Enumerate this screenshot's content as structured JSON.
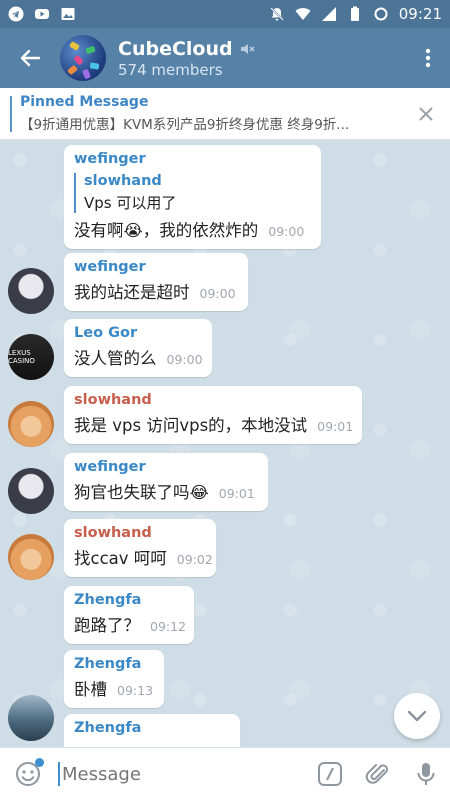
{
  "status_bar": {
    "time": "09:21",
    "left_icons": [
      "telegram-icon",
      "youtube-icon",
      "image-icon"
    ],
    "right_icons": [
      "mute-bell-icon",
      "wifi-icon",
      "signal-icon",
      "battery-icon",
      "sync-icon"
    ]
  },
  "header": {
    "title": "CubeCloud",
    "subtitle": "574 members",
    "muted_icon": "muted-speaker-icon"
  },
  "pinned": {
    "title": "Pinned Message",
    "body": "【9折通用优惠】KVM系列产品9折终身优惠  终身9折..."
  },
  "messages": [
    {
      "sender": "wefinger",
      "sender_color": "#3a88c6",
      "reply_to": "slowhand",
      "reply_text": "Vps 可以用了",
      "text": "没有啊😭，我的依然炸的",
      "time": "09:00"
    },
    {
      "sender": "wefinger",
      "sender_color": "#3a88c6",
      "text": "我的站还是超时",
      "time": "09:00"
    },
    {
      "sender": "Leo Gor",
      "sender_color": "#3a88c6",
      "text": "没人管的么",
      "time": "09:00",
      "avatar_text": "LEXUS CASINO"
    },
    {
      "sender": "slowhand",
      "sender_color": "#c65f4c",
      "text": "我是 vps 访问vps的，本地没试",
      "time": "09:01"
    },
    {
      "sender": "wefinger",
      "sender_color": "#3a88c6",
      "text": "狗官也失联了吗😂",
      "time": "09:01"
    },
    {
      "sender": "slowhand",
      "sender_color": "#c65f4c",
      "text": "找ccav 呵呵",
      "time": "09:02"
    },
    {
      "sender": "Zhengfa",
      "sender_color": "#3a88c6",
      "text": "跑路了？",
      "time": "09:12"
    },
    {
      "sender": "Zhengfa",
      "sender_color": "#3a88c6",
      "text": "卧槽",
      "time": "09:13"
    },
    {
      "sender": "Zhengfa",
      "sender_color": "#3a88c6",
      "text": "",
      "time": ""
    }
  ],
  "input": {
    "placeholder": "Message"
  },
  "colors": {
    "header_bg": "#5682a8",
    "statusbar_bg": "#4c7497",
    "accent": "#3a88c6",
    "chat_bg": "#cfdde6"
  }
}
